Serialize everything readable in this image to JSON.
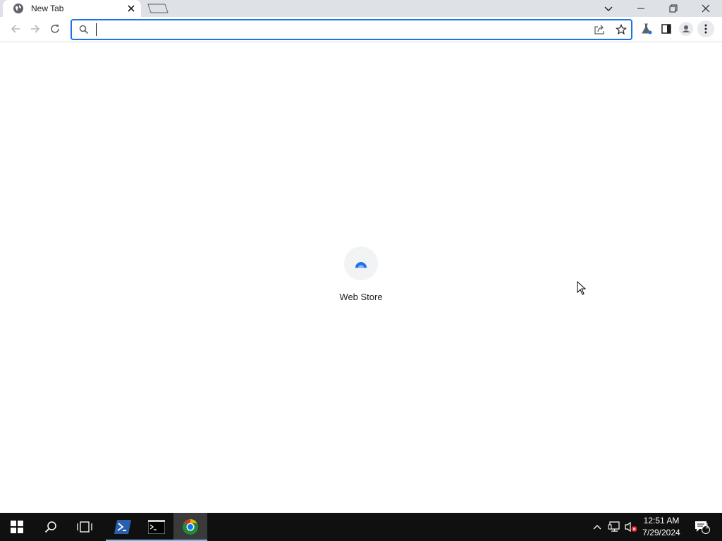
{
  "browser": {
    "tab": {
      "title": "New Tab"
    },
    "omnibox": {
      "value": "",
      "placeholder": ""
    }
  },
  "new_tab_page": {
    "shortcuts": [
      {
        "label": "Web Store"
      }
    ]
  },
  "taskbar": {
    "clock": {
      "time": "12:51 AM",
      "date": "7/29/2024"
    },
    "notification_count": "1",
    "pinned": [
      "start-icon",
      "search-icon",
      "task-view-icon",
      "powershell-icon",
      "command-prompt-icon",
      "chrome-icon"
    ]
  },
  "colors": {
    "accent": "#1a73e8",
    "tabstrip": "#dee1e6",
    "taskbar": "#101010",
    "taskbar_active": "#76b9ed"
  }
}
